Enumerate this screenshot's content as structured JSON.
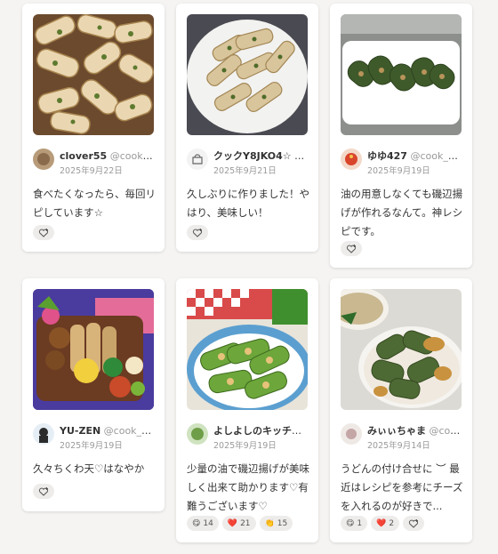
{
  "cards": [
    {
      "user": "clover55",
      "id": "@cook_40...",
      "date": "2025年9月22日",
      "comment": "食べたくなったら、毎回リピしています☆"
    },
    {
      "user": "クックY8JKO4☆",
      "id": "@c...",
      "date": "2025年9月21日",
      "comment": "久しぶりに作りました！やはり、美味しい！"
    },
    {
      "user": "ゆゆ427",
      "id": "@cook_412...",
      "date": "2025年9月19日",
      "comment": "油の用意しなくても磯辺揚げが作れるなんて。神レシピです。"
    },
    {
      "user": "YU-ZEN",
      "id": "@cook_400...",
      "date": "2025年9月19日",
      "comment": "久々ちくわ天♡はなやか"
    },
    {
      "user": "よしよしのキッチン...",
      "id": "",
      "date": "2025年9月19日",
      "comment": "少量の油で磯辺揚げが美味しく出来て助かります♡有難うございます♡",
      "reactions": [
        {
          "emoji": "😋",
          "count": "14"
        },
        {
          "emoji": "❤️",
          "count": "21"
        },
        {
          "emoji": "👏",
          "count": "15"
        }
      ]
    },
    {
      "user": "みぃぃちゃま",
      "id": "@cook...",
      "date": "2025年9月14日",
      "comment": "うどんの付け合せに ︶ 最近はレシピを参考にチーズを入れるのが好きで...",
      "reactions": [
        {
          "emoji": "😋",
          "count": "1"
        },
        {
          "emoji": "❤️",
          "count": "2"
        }
      ]
    }
  ],
  "icons": {
    "like": "heart-plus-icon"
  }
}
